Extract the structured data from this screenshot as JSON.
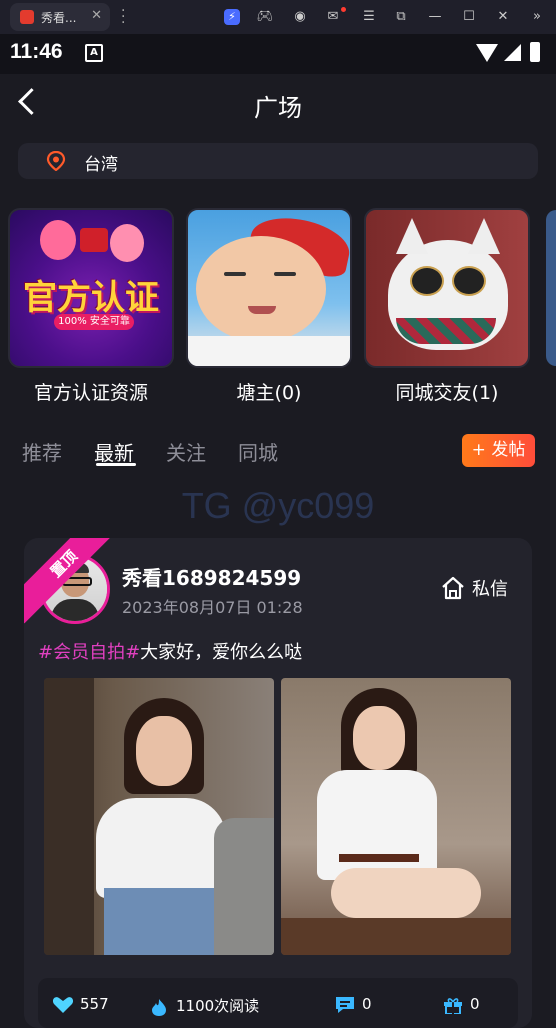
{
  "browser": {
    "tab_title": "秀看...",
    "tab_close": "✕"
  },
  "status_bar": {
    "time": "11:46",
    "notif_icon": "A"
  },
  "header": {
    "title": "广场"
  },
  "location": {
    "city": "台湾"
  },
  "categories": [
    {
      "label": "官方认证资源",
      "badge_text": "官方认证",
      "badge_sub": "100% 安全可靠"
    },
    {
      "label": "塘主(0)"
    },
    {
      "label": "同城交友(1)"
    }
  ],
  "tabs": [
    "推荐",
    "最新",
    "关注",
    "同城"
  ],
  "active_tab": "最新",
  "post_button": "+ 发帖",
  "watermark": "TG @yc099",
  "post": {
    "pinned_label": "置顶",
    "username": "秀看1689824599",
    "date": "2023年08月07日 01:28",
    "dm_label": "私信",
    "tag": "#会员自拍#",
    "text": "大家好，爱你么么哒",
    "stats": {
      "likes": "557",
      "views": "1100次阅读",
      "comments": "0",
      "gifts": "0"
    }
  },
  "colors": {
    "background": "#1b1b22",
    "accent_pink": "#e91e9a",
    "accent_orange": "#ff6a2a",
    "location_pin": "#ff5a2a"
  }
}
